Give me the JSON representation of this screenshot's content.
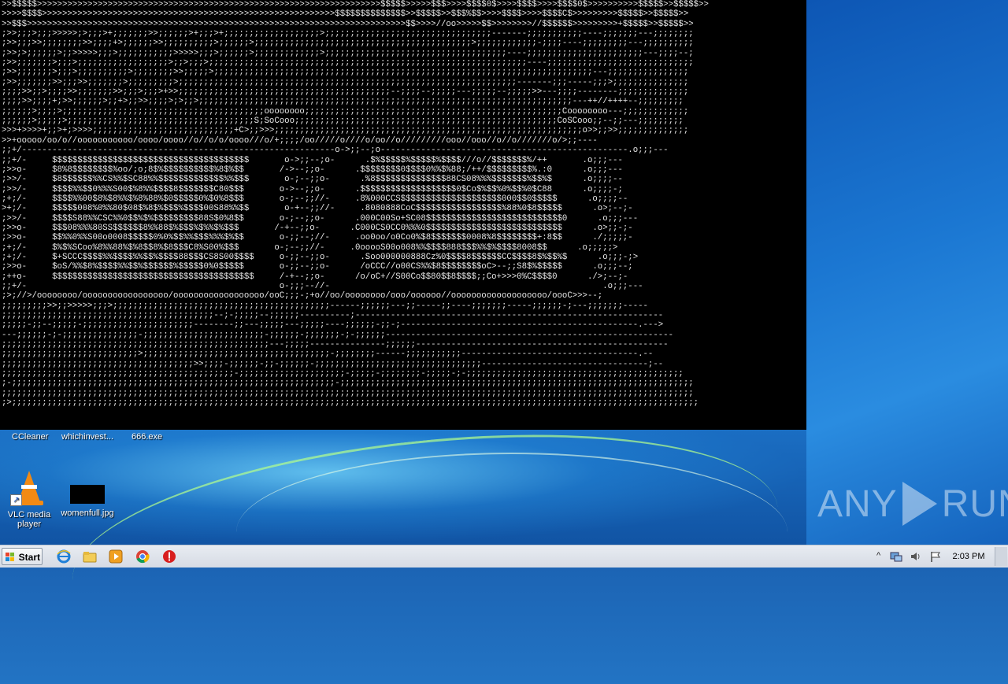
{
  "console": {
    "lines": [
      ">>$$$$$>>>>>>>>>>>>>>>>>>>>>>>>>>>>>>>>>>>>>>>>>>>>>>>>>>>>>>>>>>>>>>>>>>>>$$$$$>>>>>$$$>>>>$$$$0$>>>>$$$$>>>>$$$$0$>>>>>>>>>>$$$$$>>$$$$$>>",
      ">>>>$$$$>>>>>>>>>>>>>>>>>>>>>>>>>>>>>>>>>>>>>>>>>>>>>>>>>>>>>>>>>>$$$$$$$$$$$$$$>>$$$$$>>$$$%$$>>>>$$$$>>>>$$$$C$>>>>>>>>>$$$$$>>$$$$$>>",
      ">>$$$>>>>>>>>>>>>>>>>>>>>>>>>>>>>>>>>>>>>>>>>>>>>>>>>>>>>>>>>>>>>>>>>>>>>>>>>>>>$$>>>>//oo>>>>>$$>>>>>>>>//$$$$$$>>>>>>>>>+$$$$$>>$$$$$>>",
      ";>>;;;>;;;>>>>>;>;;;>+;;;;;;;>>;;;;;;>+;;;>+;;;;;;;;;;;;;;;;;;;>;;;;;;;;;;;;;;;;;;;;;;;;;;;;;;;;;-------;;;;;;;;;;;----;;;;;;;---;;;;;;;;",
      ";>>;;;>>;;;;;;;;>>;;;;+>;;;;;;>>;;;;;;;;;;>;;;;;;>;;;;;;;;;;;;;;;;;;;;;;;;;;;;;;;;;;;;;;;;;;;>;;;;;;;;;;;;-;;;;----;;;;;;;;;---;;;;;;;;;;",
      ";>>;>;;;;;;>;;>>>>>;;;>;;;;;;;;;;;>>>>>;;;>;;;;;;>;;;;;;;;;;;;;>;;;;;;;;;;;;;;;;;;;;;;;;;;;;;;;;;;;;----;;;;;;;;;;;;;;;;;;;;;;;---;;;;--;",
      ";>>;;;;;;;>;;;>;;;;;;;;;;;;;;;;;;>;;>;;;>;;;;;;;;;;;;;;;;;;;;;;;;;;;;;;;;;;;;;;;;;;;;;;;;;;;;;;;;;;;;;;;----;;;;;;;;;;;;;;;;;;;;;;;;;;;;;",
      ";>>;;;;;;;>;;;>;;;;;;;;;;>;;;;;;;;>>;;;;;>;;;;;;;;;;;;;;;;;;;;;;;;;;;;;;;;;;;;;;;;;;;;;;;;;;;;;;;;;;;;;;;;;;;;;;;;;;;---;;;;;;;;;;;;;;;;",
      ";>>;;;;;;;>>;;;>>;;;;;;;>;;;;;;;;;>;;;;;;;;;;;;;;;;;;;;;;;;;;;;;;;;;;;;;;;;;;;;;;;;;;;;;;;;;;;;;;;;;;;-------;;;-----;;;>;;;;;;;;;;;;;;;",
      ";;;;>>;;>;;;;>>;;;;;;;>>;;;>;;;>+>>;;;;;;;;;;;;;;;;;;;;;;;;;;;;;;;;;;;;;;;;;;--;;;;--;;;;;---;;;;;--;;;;;>>---;;;;--------;;;;;;;;;;;;;;",
      ";;;;>>;;;;+;>>;;;;;;>;;+>;;>>;;;;>;>;;>;;;;;;;;;;;;;;;;;;;;;;;;;;;;;;;;;;;;;;;;;;;;;;;;;;;;;;;;;;;;;;;;;;;;;;;;;;---++//++++--;;;;;;;;;",
      ";;;;;;>;;;;>;;;;;;;;;;;;;;;;;;;;;;;;;;;;;;;;;;;;;;;;oooooooo;;;;;;;;;;;;;;;;;;;;;;;;;;;;;;;;;;;;;;;;;;;;;;;;;;;Coooooooo---;;;;;;;;;;;;;",
      ";;;;;;>;;;;;>;;;;;;;;;;;;;;;;;;;;;;;;;;;;;;;;;;;;;S;SoCooo;;;;;;;;;;;;;;;;;;;;;;;;;;;;;;;;;;;;;;;;;;;;;;;;;;;;CoSCooo;;--;;---;;;;;;;;;",
      ">>>+>>>>+;;>+;>>>>;;;;;;;;;;;;;;;;;;;;;;;;;;;;+C>;;>>>;;;;;;;;;;;;;;;;;;;;;;;;;;;;;;;;;;;;;;;;;;;;;;;;;;;;;;;;;;;;;o>>;;>>;;;;;;;;;;;;;;",
      ">>+ooooo/oo/o//ooooooooooo/oooo/oooo//o//o/o/oooo///o/+;;;;/oo/////o////o/oo//o/////////ooo//ooo//o//o///////o/>;;----",
      ";;+/--------------------------------------------------------------o->;;--;o-------------------------------------------------.o;;;---",
      ";;+/-     $$$$$$$$$$$$$$$$$$$$$$$$$$$$$$$$$$$$$$$       o->;;--;o-      .$%$$$$$%$$$$$%$$$$///o//$$$$$$$%/++       .o;;;---",
      ";>>o-     $8%8$$$$$$$$%oo/;o;8$%$$$$$$$$$$%8$%$$       /->--;;o-      .$$$$$$$$0$$$$0%%$%88;/++/$$$$$$$$$%.:0      .o;;;---",
      ";>>/-     $8$$$$$$%%CS%%$SC88%%$$$$$$$$$$$$$%%$$$       o-;--;;o-      .%8$$$$$$$$$$$$$$88CS08%%%$$$$$$$%$$%$      .o;;;;--",
      ";>>/-     $$$$%%$$0%%%S00$%8%%$$$$8$$$$$$$C80$$$       o->--;;o-      .$$$$$$$$$$$$$$$$$$$0$Co$%$$%0%$$%0$C88      .o;;;;-;",
      ";+;/-     $$$$%%00$8%$8%%$%8%88%$0$$$$$0%$0%8$$$       o-;--;;//-     .8%000CCS$$$$$$$$$$$$$$$$$$$$000$$0$$$$$      .o;;;;--",
      ">+;/-     $$$$$008%0%%80$08$%8$%$$$%$$$$00S88%%$$       o-+--;;//-     .8080888CoC$$$$$$$$$$$$$$$$$%88%0$8$$$$$      .o>;--;-",
      ";>>/-     $$$$S88%%CSC%%0$$%$%$$$$$$$$$88S$0%8$$       o-;--;;o-      .000C00So+SC08$$$$$$$$$$$$$$$$$$$$$$$$$$$0      .o;;;---",
      ";>>o-     $$$08%%%80SS$$$$$$8%%88$%$$$%$%%$%$$$       /-+--;;o-      .C000CS0CC0%%%0$$$$$$$$$$$$$$$$$$$$$$$$$$$      .o>;;-;-",
      ";>>o-     $$%%0%%S00o0008$$$$$0%0%$$%%$$$%%%$%$$       o-;;--;//-     .oo0oo/o0Co0%$8$$$$$$$0008%8$$$$$$$$+:8$$      ./;;;;;-",
      ";+;/-     $%$%SCoo%8%%88%$%8$$8%$8$$$C8%S00%$$$       o-;--;;//-     .0ooooS00o008%%$$$$888$$$%%$%$$$$8008$$      .o;;;;;>",
      ";+;/-     $+SCCC$$$$%%$$$$%%$$%$$$$88$$$CS8S00$$$$     o-;;--;;o-      .Soo000000888Cz%0$$$$8$$$$$$CC$$$$8$%$$%$      .o;;;-;>",
      ";>>o-     $oS/%%$8%$$$$%%$$%$$$$$$%$$$$$0%0$$$$$       o-;;--;;o-      /oCCC//o00CS%%$8$$$$$$$$oC>--;;S8$%$$$$$      .o;;;--;",
      ";++o-     $$$$$$$$$$$$$$$$$$$$$$$$$$$$$$$$$$$$$$$$     /-+--;;o-      /o/oC+//S00Co$$80$$8$$$$;;Co+>>>0%C$$$$0      ./>;--;-",
      ";;+/-                                                  o-;;;--//-                                                      .o;;;---",
      ";>;//>/oooooooo/ooooooooooooooooo/oooooooooooooooooo/ooC;;;-;+o//oo/oooooooo/ooo/oooooo//ooooooooooooooooooo/oooC>>>--;",
      ";;;;;;;;;>>;;>>>>>;;;>;;;;;;;;;;;;;;;;;;;;;;;;;;;;;;;;;;;;;;;;;;;------;;;;;;---;;-----;;----;;;;;;;-----;;;;;;-;---;;;;;;;-----",
      ";;;;;;;;;;;;;;;;;;;;;;;;;;;;;;;;;;;;;;;;;;--;-;;;;;--;;;;;;----------;-------------------------------------------------------------",
      ";;;;;-;;--;;;;;-;;;;;;;;;;;;;;;;;;;;;;--------;;---;;;;;---;;;;;----;;;;;;-;;-;-----------------------------------------------.--->",
      "---;;;;;;-;-;;;;;;;;;;;;;;;-;;;;;;;;;;;;;;;;;;;;;;;;-;;;;;;-;;;;;;;-;-;;;;;;---------------------------------------------------------",
      ";;;;;;;;;;;;;;;;;;;;;;;;;;;;;;;;;;;;;;;;;;;;;;;;;;;;;---;;;;;---------------;;;;;;--------------------------------------------------",
      ";;;;;;;;;;;;;;;;;;;;;;;;;;;>;;;;;;;;;;;;;;;;;;;;;;;;;;;;;;;;;;;;;-;;;;;;;;------;;;;;;;;;;;-----------------------------------.--",
      ";;;;;;;;;;;;;;;;;;;;;;;;;;;;;;;;;;;;;;>>;;;;-;;;;;;-;;-;;;;;;-;;;;;;;;;;;;;;;;;;;;;;;;;;;;;;;;;---------------------------------;--",
      ";;;;;;;;;;;;;;;;;;;;;;;;;;;;;;;;;;;;;;;;;;;;;;-;;;;;;;;;;;;;;;;;;;;;-;;;;;-;;;;;;;;-;;;;;-;-;;;;;;;;;;;;;;;;;;;;;;;;;;;;;;;;;;;;;;;;;;;",
      ";-;;;;;;;;;;;;;;;;;;;;;;;;;;;;;;;;;;;;;;;;;;;;;;;;;;;;;;;;;;;;;;;;-;;;;;;;;;;;;;;;;;;;;;;;;;;;;;;;;;;;;;;;;;;;;;;;;;;;;;;;;;;;;;;;;;;;;;;",
      ";;;;;;;;;;;;;;;;;;;;;;;;;;;;;;;;;;;;;;;;;;;;;;;;;;;;;;;;;;;;;;;;;;;;;;;;;;;;;;;;;;;;;;;;;;;;;;;;;;;;;;;;;;;;;;;;;;;;;;;;;;;;;;;;;;;;;;;;;",
      ";>;;;;;;;;;;;;;;;;;;;;;;;;;;;;;;;;;;;;;;;;;;;;;;;;;;;;;;;;;;;;;;;;;;;;;;;;;;;;;;;;;;;;;;;;;;;;;;;;;;;;;;;;;;;;;;;;;;;;;;;;;;;;;;;;;;;;;;;;"
    ]
  },
  "desktop": {
    "top_labels": [
      "CCleaner",
      "whichinvest...",
      "666.exe"
    ],
    "icons": [
      {
        "label_line1": "VLC media",
        "label_line2": "player",
        "icon": "vlc-cone-icon"
      },
      {
        "label_line1": "womenfull.jpg",
        "label_line2": "",
        "icon": "image-thumbnail-icon"
      }
    ],
    "watermark_left": "ANY",
    "watermark_right": "RUN"
  },
  "taskbar": {
    "start_label": "Start",
    "pinned": [
      "internet-explorer-icon",
      "explorer-folder-icon",
      "media-player-icon",
      "chrome-icon",
      "stop-icon"
    ],
    "tray_chevron": "^",
    "clock": "2:03 PM"
  },
  "colors": {
    "console_bg": "#000000",
    "console_fg": "#e8e8e8",
    "desktop_blue": "#1c64b4",
    "taskbar_bg": "#dfe3ea"
  }
}
